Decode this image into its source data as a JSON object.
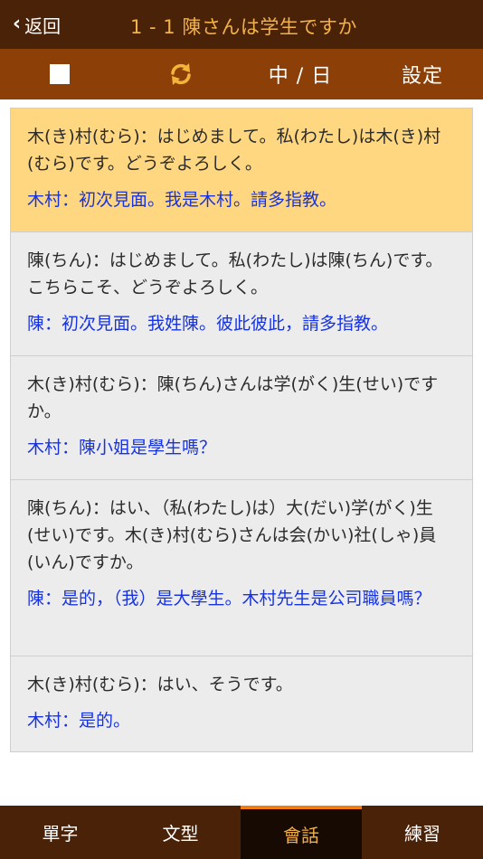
{
  "header": {
    "back_label": "返回",
    "title": "1 - 1 陳さんは学生ですか"
  },
  "toolbar": {
    "language_toggle": "中 / 日",
    "settings_label": "設定"
  },
  "colors": {
    "header_bg": "#4a2208",
    "toolbar_bg": "#8c3f07",
    "accent_orange": "#f2b24b",
    "active_card_bg": "#ffd780",
    "translation_blue": "#1733e0"
  },
  "dialogue": [
    {
      "jp": "木(き)村(むら)：はじめまして。私(わたし)は木(き)村(むら)です。どうぞよろしく。",
      "zh": "木村：初次見面。我是木村。請多指教。"
    },
    {
      "jp": "陳(ちん)：はじめまして。私(わたし)は陳(ちん)です。こちらこそ、どうぞよろしく。",
      "zh": "陳：初次見面。我姓陳。彼此彼此，請多指教。"
    },
    {
      "jp": "木(き)村(むら)：陳(ちん)さんは学(がく)生(せい)ですか。",
      "zh": "木村：陳小姐是學生嗎？"
    },
    {
      "jp": "陳(ちん)：はい、（私(わたし)は）大(だい)学(がく)生(せい)です。木(き)村(むら)さんは会(かい)社(しゃ)員(いん)ですか。",
      "zh": "陳：是的，（我）是大學生。木村先生是公司職員嗎？"
    },
    {
      "jp": "木(き)村(むら)：はい、そうです。",
      "zh": "木村：是的。"
    }
  ],
  "tabs": {
    "vocab": "單字",
    "grammar": "文型",
    "conversation": "會話",
    "practice": "練習"
  }
}
